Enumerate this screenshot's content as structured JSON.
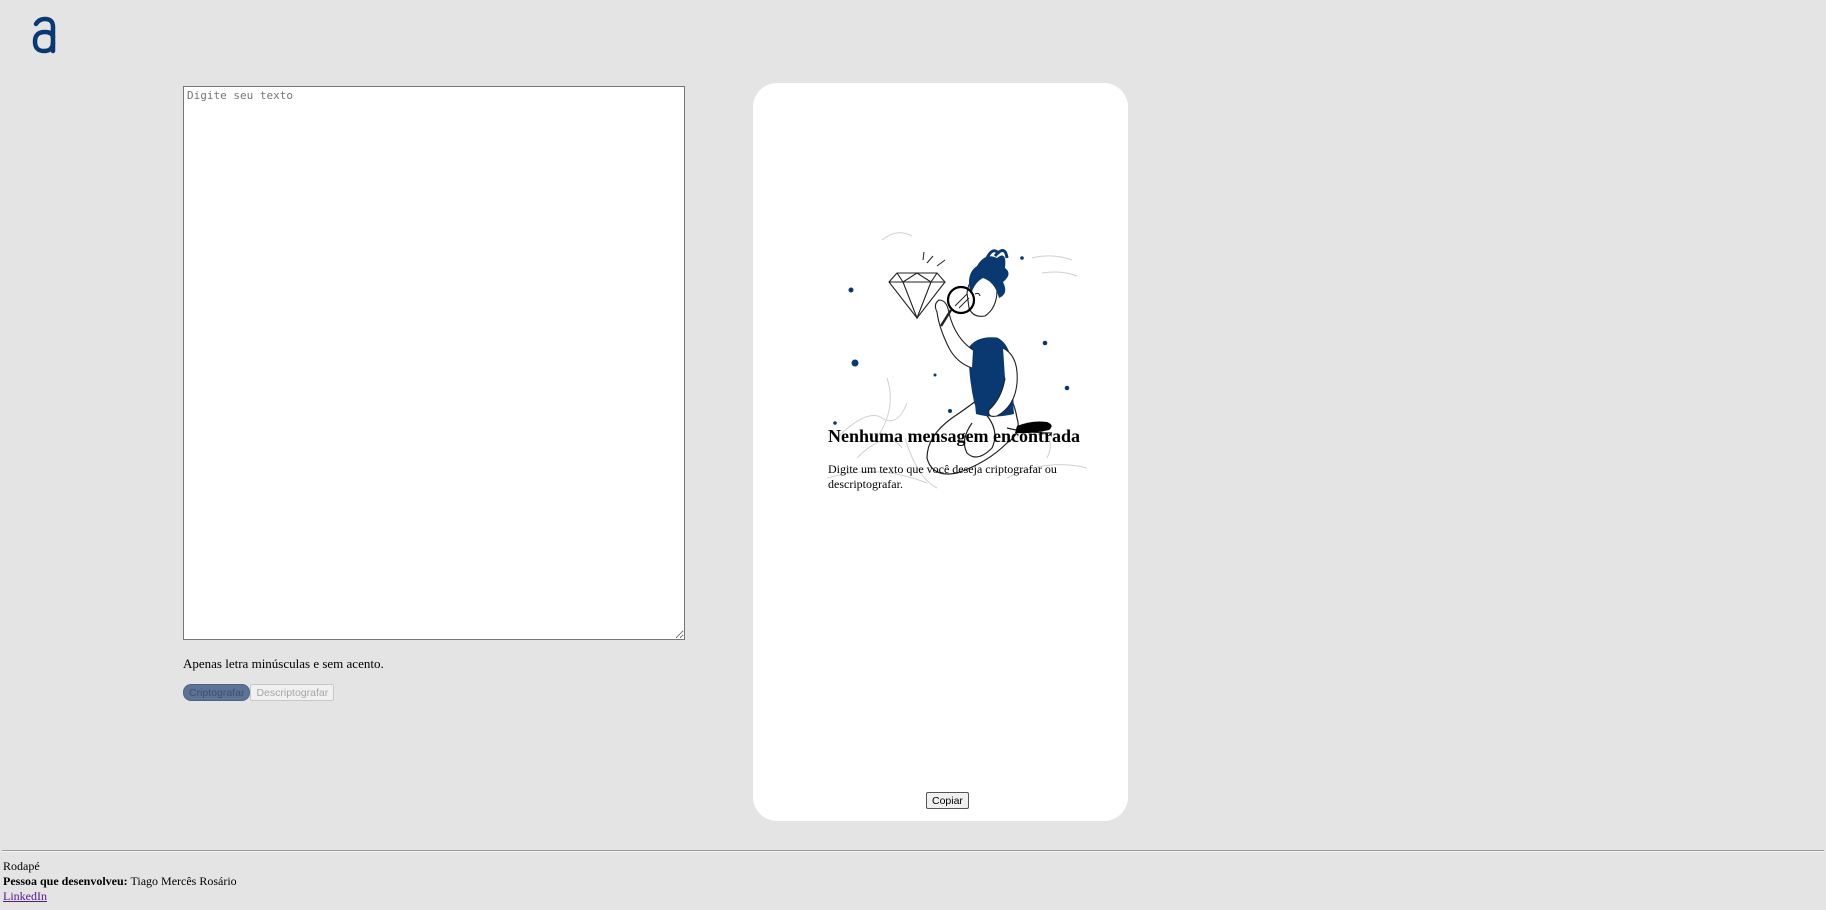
{
  "header": {
    "logo_icon": "alura-a-logo",
    "logo_color": "#0a3871"
  },
  "input": {
    "placeholder": "Digite seu texto",
    "value": "",
    "hint": "Apenas letra minúsculas e sem acento."
  },
  "actions": {
    "encrypt_label": "Criptografar",
    "decrypt_label": "Descriptografar"
  },
  "output": {
    "illustration_icon": "person-with-magnifier-illustration",
    "title": "Nenhuma mensagem encontrada",
    "text": "Digite um texto que você deseja criptografar ou descriptografar.",
    "copy_label": "Copiar"
  },
  "footer": {
    "caption": "Rodapé",
    "developer_label": "Pessoa que desenvolveu:",
    "developer_name": "Tiago Mercês Rosário",
    "link_label": "LinkedIn"
  },
  "colors": {
    "accent": "#0a3871",
    "background": "#e4e4e5"
  }
}
